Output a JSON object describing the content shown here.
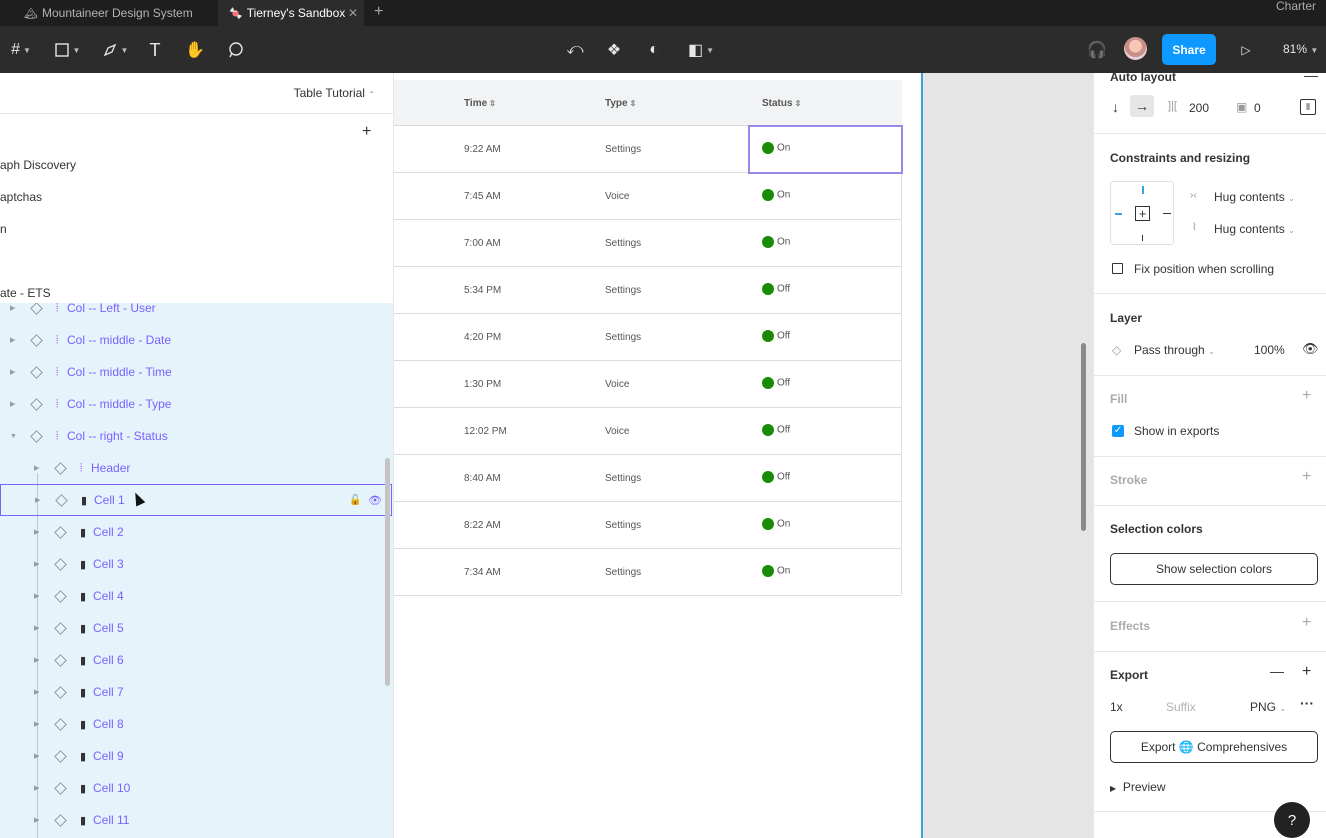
{
  "tabs": [
    {
      "icon": "🏔",
      "label": "Mountaineer Design System"
    },
    {
      "icon": "🍬",
      "label": "Tierney's Sandbox"
    }
  ],
  "account": "Charter",
  "toolbar": {
    "share_label": "Share",
    "zoom": "81%"
  },
  "left": {
    "page_selector": "Table Tutorial",
    "pages": [
      "aph Discovery",
      "aptchas",
      "n",
      "ate - ETS"
    ],
    "layers": [
      {
        "label": "Col -- Left - User"
      },
      {
        "label": "Col -- middle -  Date"
      },
      {
        "label": "Col -- middle - Time"
      },
      {
        "label": "Col -- middle - Type"
      },
      {
        "label": "Col -- right - Status"
      },
      {
        "label": "Header"
      },
      {
        "label": "Cell 1"
      },
      {
        "label": "Cell 2"
      },
      {
        "label": "Cell 3"
      },
      {
        "label": "Cell 4"
      },
      {
        "label": "Cell 5"
      },
      {
        "label": "Cell 6"
      },
      {
        "label": "Cell 7"
      },
      {
        "label": "Cell 8"
      },
      {
        "label": "Cell 9"
      },
      {
        "label": "Cell 10"
      },
      {
        "label": "Cell 11"
      }
    ]
  },
  "table": {
    "headers": [
      "Time",
      "Type",
      "Status"
    ],
    "rows": [
      {
        "time": "9:22 AM",
        "type": "Settings",
        "status": "On"
      },
      {
        "time": "7:45 AM",
        "type": "Voice",
        "status": "On"
      },
      {
        "time": "7:00 AM",
        "type": "Settings",
        "status": "On"
      },
      {
        "time": "5:34 PM",
        "type": "Settings",
        "status": "Off"
      },
      {
        "time": "4:20 PM",
        "type": "Settings",
        "status": "Off"
      },
      {
        "time": "1:30 PM",
        "type": "Voice",
        "status": "Off"
      },
      {
        "time": "12:02 PM",
        "type": "Voice",
        "status": "Off"
      },
      {
        "time": "8:40 AM",
        "type": "Settings",
        "status": "Off"
      },
      {
        "time": "8:22 AM",
        "type": "Settings",
        "status": "On"
      },
      {
        "time": "7:34 AM",
        "type": "Settings",
        "status": "On"
      }
    ]
  },
  "right": {
    "auto_layout": {
      "title": "Auto layout",
      "spacing": "200",
      "padding": "0"
    },
    "constraints": {
      "title": "Constraints and resizing",
      "horizontal": "Hug contents",
      "vertical": "Hug contents",
      "fix_position": "Fix position when scrolling"
    },
    "layer": {
      "title": "Layer",
      "blend": "Pass through",
      "opacity": "100%"
    },
    "fill": {
      "title": "Fill",
      "show_in_exports": "Show in exports"
    },
    "stroke": {
      "title": "Stroke"
    },
    "selection_colors": {
      "title": "Selection colors",
      "button": "Show selection colors"
    },
    "effects": {
      "title": "Effects"
    },
    "export": {
      "title": "Export",
      "scale": "1x",
      "suffix_placeholder": "Suffix",
      "format": "PNG",
      "button": "Export 🌐 Comprehensives",
      "preview": "Preview"
    }
  },
  "colors": {
    "accent": "#7b61ff",
    "share": "#0d99ff",
    "status_dot": "#198b06"
  }
}
